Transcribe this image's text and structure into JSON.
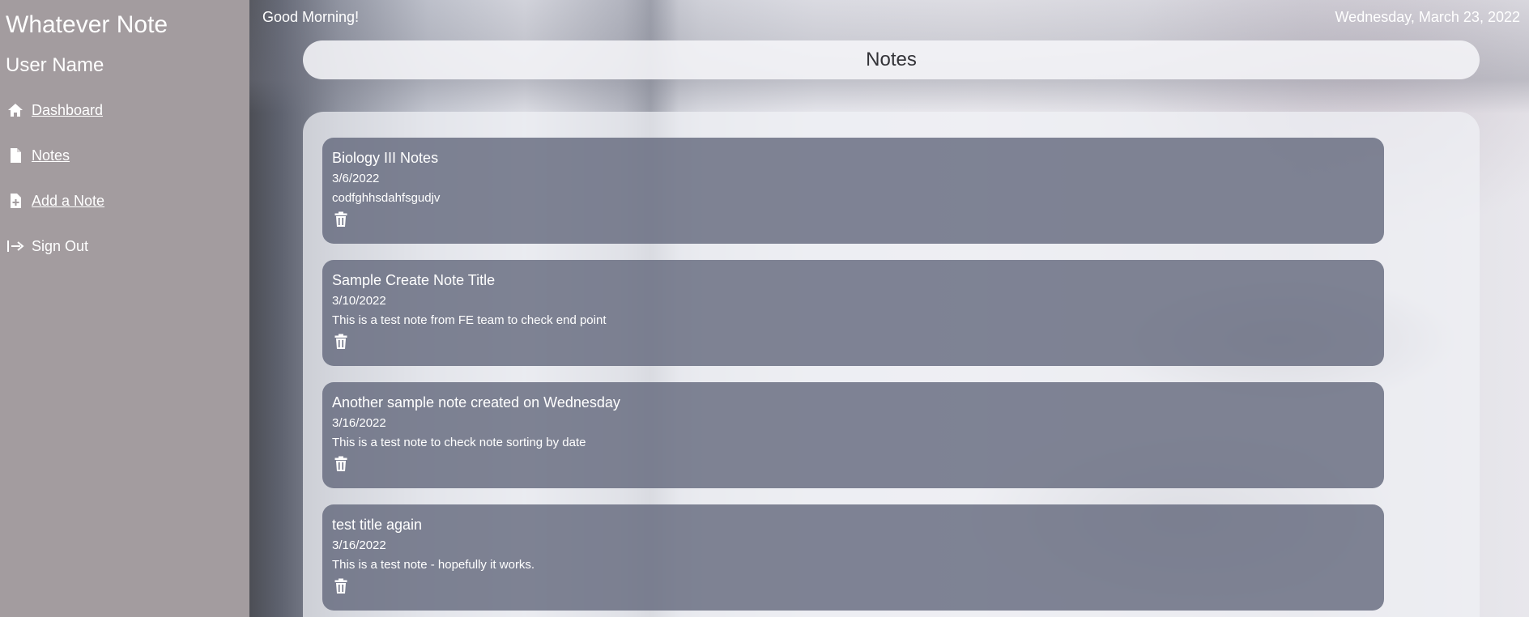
{
  "sidebar": {
    "app_title": "Whatever Note",
    "user_name": "User Name",
    "nav": [
      {
        "label": "Dashboard",
        "icon": "home-icon"
      },
      {
        "label": "Notes",
        "icon": "document-icon"
      },
      {
        "label": "Add a Note",
        "icon": "add-document-icon"
      },
      {
        "label": "Sign Out",
        "icon": "sign-out-icon"
      }
    ]
  },
  "header": {
    "greeting": "Good Morning!",
    "date": "Wednesday, March 23, 2022",
    "page_title": "Notes"
  },
  "notes": [
    {
      "title": "Biology III Notes",
      "date": "3/6/2022",
      "body": "codfghhsdahfsgudjv",
      "delete_icon": "trash-icon"
    },
    {
      "title": "Sample Create Note Title",
      "date": "3/10/2022",
      "body": "This is a test note from FE team to check end point",
      "delete_icon": "trash-icon"
    },
    {
      "title": "Another sample note created on Wednesday",
      "date": "3/16/2022",
      "body": "This is a test note to check note sorting by date",
      "delete_icon": "trash-icon"
    },
    {
      "title": "test title again",
      "date": "3/16/2022",
      "body": "This is a test note - hopefully it works.",
      "delete_icon": "trash-icon"
    }
  ],
  "colors": {
    "sidebar_bg": "#a39c9f",
    "card_bg": "#5f6478",
    "text": "#ffffff",
    "header_text": "#333338"
  }
}
